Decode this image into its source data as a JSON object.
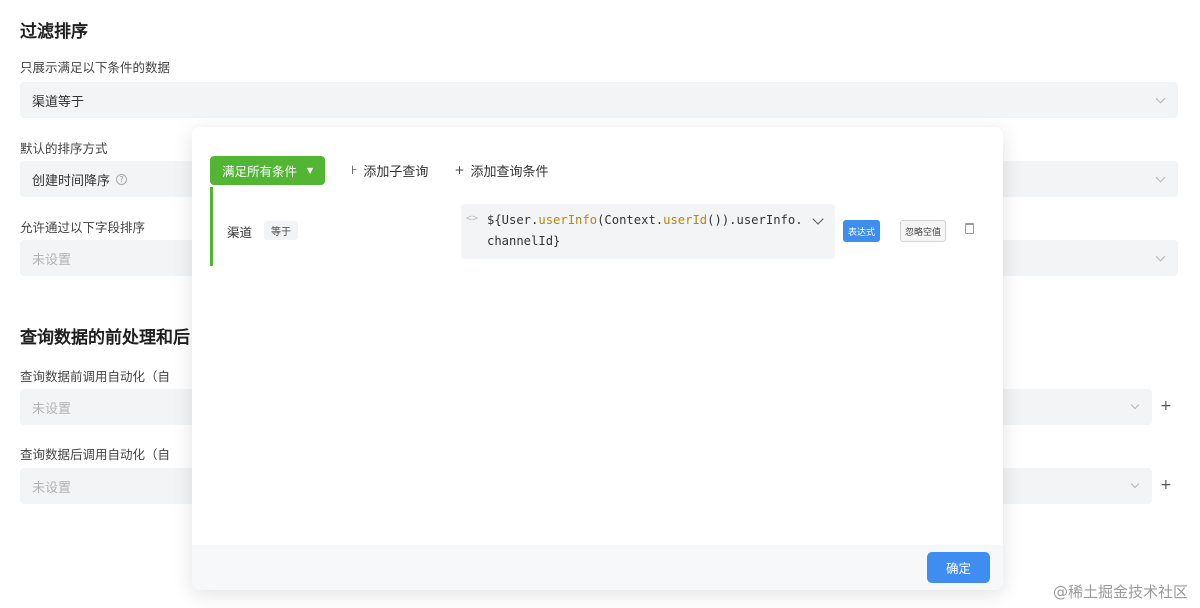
{
  "background": {
    "filter_section_title": "过滤排序",
    "filter_label": "只展示满足以下条件的数据",
    "filter_value": "渠道等于",
    "sort_label": "默认的排序方式",
    "sort_value": "创建时间降序",
    "sort_fields_label": "允许通过以下字段排序",
    "sort_fields_placeholder": "未设置",
    "preprocess_section_title": "查询数据的前处理和后",
    "pre_label": "查询数据前调用自动化（自",
    "pre_placeholder": "未设置",
    "post_label": "查询数据后调用自动化（自",
    "post_placeholder": "未设置",
    "plus": "+"
  },
  "modal": {
    "match_button": "满足所有条件",
    "add_subquery": "添加子查询",
    "add_condition": "添加查询条件",
    "condition": {
      "field": "渠道",
      "operator": "等于",
      "expression_prefix": "${User.",
      "expression_fn1": "userInfo",
      "expression_mid": "(Context.",
      "expression_fn2": "userId",
      "expression_suffix": "()).userInfo.channelId}",
      "expr_button": "表达式",
      "empty_button": "忽略空值"
    },
    "confirm_button": "确定"
  },
  "watermark": "@稀土掘金技术社区",
  "colors": {
    "accent_green": "#52b534",
    "accent_blue": "#3d8ef0"
  },
  "icons": {
    "subquery": "branch-icon",
    "add": "plus-icon",
    "code": "code-icon",
    "delete": "trash-icon"
  }
}
